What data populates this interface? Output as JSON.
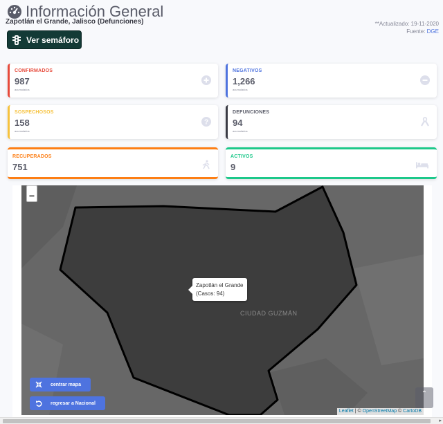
{
  "header": {
    "title": "Información General",
    "subtitle": "Zapotlán el Grande, Jalisco (Defunciones)",
    "updated": "**Actualizado: 19-11-2020",
    "source_prefix": "Fuente:",
    "source_link": "DGE",
    "semaforo_button": "Ver semáforo",
    "title_icon": "tachometer-icon"
  },
  "cards": {
    "confirmados": {
      "label": "CONFIRMADOS",
      "value": "987",
      "sub": "acumulados",
      "color": "#e74a3b",
      "icon": "plus-circle-icon"
    },
    "negativos": {
      "label": "NEGATIVOS",
      "value": "1,266",
      "sub": "acumulados",
      "color": "#4e73df",
      "icon": "minus-circle-icon"
    },
    "sospechosos": {
      "label": "SOSPECHOSOS",
      "value": "158",
      "sub": "acumulados",
      "color": "#f6c23e",
      "icon": "question-circle-icon"
    },
    "defunciones": {
      "label": "DEFUNCIONES",
      "value": "94",
      "sub": "acumulados",
      "color": "#3a3b45",
      "icon": "ribbon-icon"
    },
    "recuperados": {
      "label": "RECUPERADOS",
      "value": "751",
      "color": "#fd7e14",
      "icon": "walking-icon"
    },
    "activos": {
      "label": "ACTIVOS",
      "value": "9",
      "color": "#1cc88a",
      "icon": "bed-icon"
    }
  },
  "map": {
    "tooltip_line1": "Zapotlán el Grande",
    "tooltip_line2": "(Casos: 94)",
    "city_label": "CIUDAD GUZMÁN",
    "zoom_out": "−",
    "center_button": "centrar mapa",
    "back_button": "regresar a Nacional",
    "attribution_leaflet": "Leaflet",
    "attribution_osm": "OpenStreetMap",
    "attribution_carto": "CartoDB",
    "attribution_sep": " | © ",
    "attribution_sep2": " © "
  }
}
